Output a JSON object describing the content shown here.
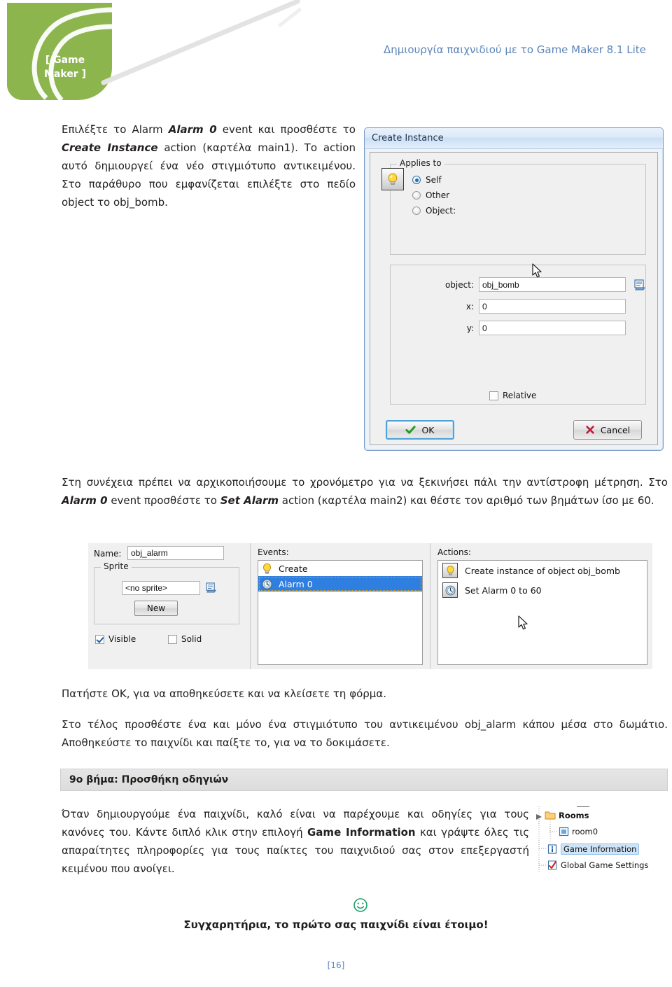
{
  "header": {
    "logo_line1": "[ Game",
    "logo_line2": "Maker ]",
    "doc_title": "Δημιουργία παιχνιδιού με το Game Maker  8.1 Lite",
    "logo_color": "#8db54e",
    "title_color": "#5b84b8"
  },
  "intro": {
    "p1_a": "Επιλέξτε το Alarm ",
    "p1_b": "Alarm 0",
    "p1_c": " event και προσθέστε το ",
    "p1_d": "Create Instance",
    "p1_e": " action (καρτέλα main1). Το action αυτό δημιουργεί ένα νέο στιγμιότυπο αντικειμένου. Στο παράθυρο που εμφανίζεται επιλέξτε στο πεδίο object το obj_bomb."
  },
  "create_instance_dialog": {
    "title": "Create Instance",
    "icon": "lightbulb-icon",
    "applies_to": {
      "legend": "Applies to",
      "options": [
        {
          "label": "Self",
          "selected": true
        },
        {
          "label": "Other",
          "selected": false
        },
        {
          "label": "Object:",
          "selected": false
        }
      ]
    },
    "fields": [
      {
        "label": "object:",
        "value": "obj_bomb",
        "has_menu_button": true
      },
      {
        "label": "x:",
        "value": "0",
        "has_menu_button": false
      },
      {
        "label": "y:",
        "value": "0",
        "has_menu_button": false
      }
    ],
    "relative": {
      "label": "Relative",
      "checked": false
    },
    "ok_button": "OK",
    "cancel_button": "Cancel",
    "cursor": "mouse-pointer"
  },
  "mid": {
    "p2_a": "Στη συνέχεια πρέπει να αρχικοποιήσουμε το χρονόμετρο για να ξεκινήσει πάλι την αντίστροφη μέτρηση. Στο ",
    "p2_b": "Alarm 0",
    "p2_c": " event προσθέστε το ",
    "p2_d": "Set Alarm",
    "p2_e": " action (καρτέλα main2) και θέστε τον αριθμό των βημάτων ίσο με 60."
  },
  "object_editor": {
    "name_label": "Name:",
    "name_value": "obj_alarm",
    "sprite_legend": "Sprite",
    "sprite_value": "<no sprite>",
    "sprite_new_button": "New",
    "visible": {
      "label": "Visible",
      "checked": true
    },
    "solid": {
      "label": "Solid",
      "checked": false
    },
    "events_label": "Events:",
    "events": [
      {
        "label": "Create",
        "icon": "lightbulb-icon",
        "selected": false
      },
      {
        "label": "Alarm 0",
        "icon": "alarm-clock-icon",
        "selected": true
      }
    ],
    "actions_label": "Actions:",
    "actions": [
      {
        "label": "Create instance of object obj_bomb",
        "icon": "lightbulb-icon"
      },
      {
        "label": "Set Alarm 0 to 60",
        "icon": "alarm-clock-icon"
      }
    ],
    "cursor": "mouse-pointer"
  },
  "post": {
    "p3": "Πατήστε OK, για να αποθηκεύσετε και να κλείσετε τη φόρμα.",
    "p4": "Στο τέλος προσθέστε ένα και μόνο ένα στιγμιότυπο του αντικειμένου obj_alarm κάπου μέσα στο δωμάτιο. Αποθηκεύστε το παιχνίδι και παίξτε το, για να το δοκιμάσετε."
  },
  "step_banner": {
    "label": "9ο βήμα: Προσθήκη οδηγιών"
  },
  "final": {
    "p5_a": "Όταν δημιουργούμε ένα παιχνίδι, καλό είναι να παρέχουμε και οδηγίες για τους κανόνες του. Κάντε διπλό κλικ στην επιλογή ",
    "p5_b": "Game Information",
    "p5_c": " και γράψτε όλες τις απαραίτητες πληροφορίες  για τους παίκτες του παιχνιδιού σας στον επεξεργαστή κειμένου που ανοίγει."
  },
  "resource_tree": {
    "items": [
      {
        "label": "Rooms",
        "icon": "folder-icon",
        "bold": true,
        "selected": false
      },
      {
        "label": "room0",
        "icon": "room-icon",
        "bold": false,
        "selected": false
      },
      {
        "label": "Game Information",
        "icon": "info-icon",
        "bold": false,
        "selected": true
      },
      {
        "label": "Global Game Settings",
        "icon": "checkmark-icon",
        "bold": false,
        "selected": false
      }
    ]
  },
  "footer": {
    "smiley": "smiley-face-icon",
    "congrats": "Συγχαρητήρια, το πρώτο σας παιχνίδι είναι έτοιμο!",
    "page_number": "[16]"
  }
}
